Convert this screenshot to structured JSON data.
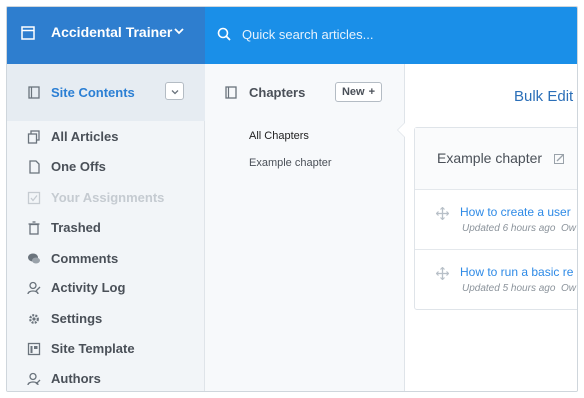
{
  "header": {
    "app_name": "Accidental Trainer",
    "search_placeholder": "Quick search articles..."
  },
  "sidebar": {
    "section_title": "Site Contents",
    "items": [
      {
        "label": "All Articles",
        "icon": "copy-icon",
        "disabled": false
      },
      {
        "label": "One Offs",
        "icon": "document-icon",
        "disabled": false
      },
      {
        "label": "Your Assignments",
        "icon": "check-box-icon",
        "disabled": true
      },
      {
        "label": "Trashed",
        "icon": "trash-icon",
        "disabled": false
      },
      {
        "label": "Comments",
        "icon": "chat-bubble-icon",
        "disabled": false
      },
      {
        "label": "Activity Log",
        "icon": "user-activity-icon",
        "disabled": false
      },
      {
        "label": "Settings",
        "icon": "gear-icon",
        "disabled": false
      },
      {
        "label": "Site Template",
        "icon": "template-icon",
        "disabled": false
      },
      {
        "label": "Authors",
        "icon": "user-edit-icon",
        "disabled": false
      }
    ]
  },
  "chapters": {
    "title": "Chapters",
    "new_label": "New",
    "links": [
      {
        "label": "All Chapters",
        "active": true
      },
      {
        "label": "Example chapter",
        "active": false
      }
    ]
  },
  "main": {
    "bulk_edit_label": "Bulk Edit",
    "card_title": "Example chapter",
    "articles": [
      {
        "title": "How to create a user",
        "meta": "Updated 6 hours ago",
        "meta_extra": "Ow"
      },
      {
        "title": "How to run a basic re",
        "meta": "Updated 5 hours ago",
        "meta_extra": "Ow"
      }
    ]
  },
  "colors": {
    "topbar": "#1a8fe8",
    "brand": "#2e7ecf",
    "accent_link": "#2e8ae6"
  }
}
